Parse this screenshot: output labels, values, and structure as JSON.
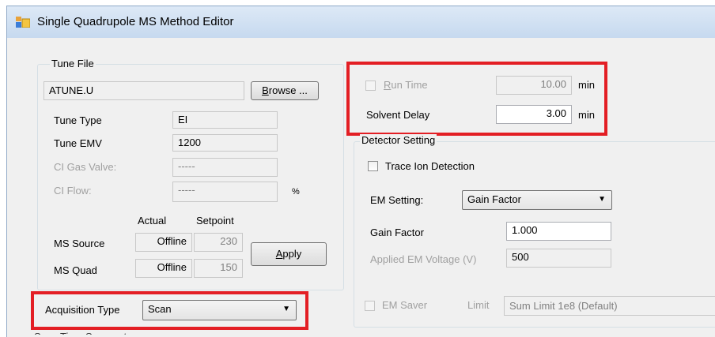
{
  "window": {
    "title": "Single Quadrupole MS Method Editor"
  },
  "tune_file": {
    "group_label": "Tune File",
    "file_value": "ATUNE.U",
    "browse_prefix": "B",
    "browse_rest": "rowse ...",
    "tune_type_label": "Tune Type",
    "tune_type_value": "EI",
    "tune_emv_label": "Tune EMV",
    "tune_emv_value": "1200",
    "ci_gas_valve_label": "CI Gas Valve:",
    "ci_gas_valve_value": "-----",
    "ci_flow_label": "CI Flow:",
    "ci_flow_value": "-----",
    "ci_flow_unit": "%",
    "actual_header": "Actual",
    "setpoint_header": "Setpoint",
    "ms_source_label": "MS Source",
    "ms_source_actual": "Offline",
    "ms_source_setpoint": "230",
    "ms_quad_label": "MS Quad",
    "ms_quad_actual": "Offline",
    "ms_quad_setpoint": "150",
    "apply_prefix": "A",
    "apply_rest": "pply"
  },
  "acquisition": {
    "label": "Acquisition Type",
    "value": "Scan"
  },
  "timing": {
    "run_time_prefix": "R",
    "run_time_rest": "un Time",
    "run_time_value": "10.00",
    "run_time_unit": "min",
    "solvent_delay_label": "Solvent Delay",
    "solvent_delay_value": "3.00",
    "solvent_delay_unit": "min"
  },
  "detector": {
    "group_label": "Detector Setting",
    "trace_ion_label": "Trace Ion Detection",
    "em_setting_label": "EM Setting:",
    "em_setting_value": "Gain Factor",
    "gain_factor_label": "Gain Factor",
    "gain_factor_value": "1.000",
    "applied_em_label": "Applied EM Voltage (V)",
    "applied_em_value": "500",
    "em_saver_label": "EM Saver",
    "limit_label": "Limit",
    "limit_value": "Sum Limit 1e8 (Default)"
  },
  "colors": {
    "highlight": "#e31e24",
    "title_bar": "#c6d9ef"
  }
}
